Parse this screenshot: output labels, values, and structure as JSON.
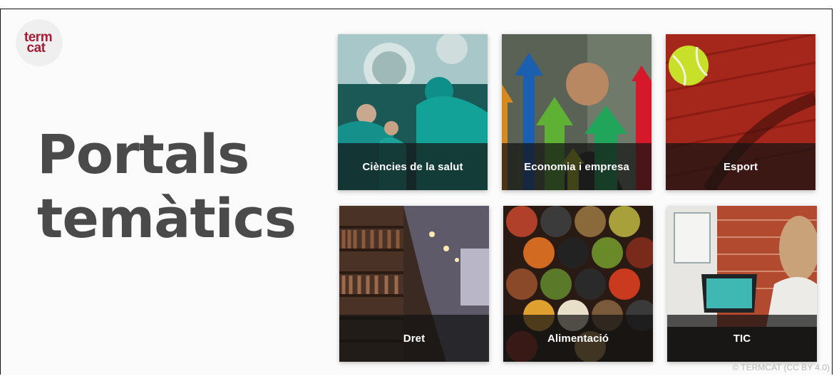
{
  "logo": {
    "line1": "term",
    "line2": "cat"
  },
  "heading": {
    "line1": "Portals",
    "line2": "temàtics"
  },
  "tiles": [
    {
      "label": "Ciències de la salut"
    },
    {
      "label": "Economia i empresa"
    },
    {
      "label": "Esport"
    },
    {
      "label": "Dret"
    },
    {
      "label": "Alimentació"
    },
    {
      "label": "TIC"
    }
  ],
  "footer": {
    "credit": "© TERMCAT (CC BY 4.0)"
  },
  "colors": {
    "brand": "#a51d36",
    "heading": "#4a4a4a",
    "caption_bg": "#141414"
  }
}
